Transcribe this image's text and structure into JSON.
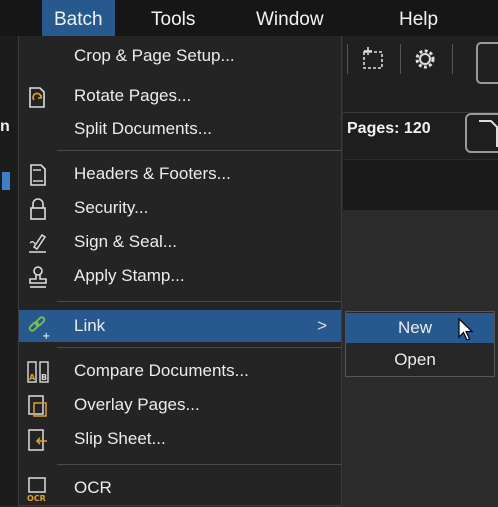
{
  "menubar": {
    "items": [
      {
        "label": "Batch",
        "active": true
      },
      {
        "label": "Tools"
      },
      {
        "label": "Window"
      },
      {
        "label": "Help"
      }
    ]
  },
  "background": {
    "pages_label": "Pages: 120",
    "left_cut_text": "n"
  },
  "batch_menu": {
    "items": [
      {
        "label": "Crop & Page Setup...",
        "icon": "crop-icon"
      },
      {
        "label": "Rotate Pages...",
        "icon": "rotate-pages-icon"
      },
      {
        "label": "Split Documents...",
        "icon": "none"
      },
      {
        "label": "Headers & Footers...",
        "icon": "header-footer-icon"
      },
      {
        "label": "Security...",
        "icon": "lock-icon"
      },
      {
        "label": "Sign & Seal...",
        "icon": "pen-signature-icon"
      },
      {
        "label": "Apply Stamp...",
        "icon": "stamp-icon"
      },
      {
        "label": "Link",
        "icon": "link-icon",
        "submenu_arrow": ">"
      },
      {
        "label": "Compare Documents...",
        "icon": "compare-icon"
      },
      {
        "label": "Overlay Pages...",
        "icon": "overlay-icon"
      },
      {
        "label": "Slip Sheet...",
        "icon": "slip-sheet-icon"
      },
      {
        "label": "OCR",
        "icon": "ocr-icon"
      }
    ]
  },
  "link_submenu": {
    "items": [
      {
        "label": "New",
        "highlighted": true
      },
      {
        "label": "Open"
      }
    ]
  },
  "colors": {
    "highlight": "#27598f",
    "menu_bg": "#242424",
    "menubar_bg": "#161616",
    "link_icon_green": "#7ec24a"
  }
}
